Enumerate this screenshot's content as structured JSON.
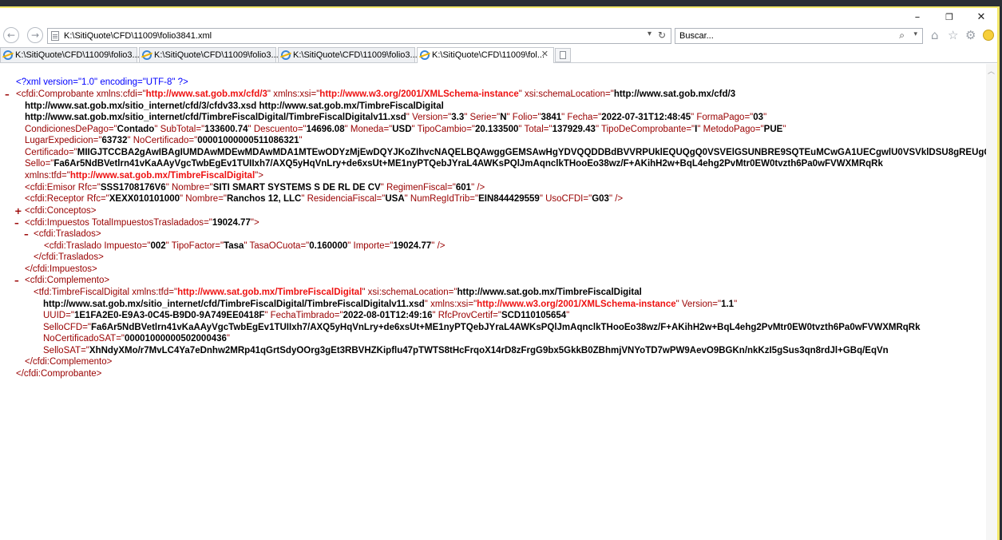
{
  "window": {
    "minimize": "–",
    "maximize": "❐",
    "close": "✕"
  },
  "nav": {
    "back_icon": "arrow-left",
    "forward_icon": "arrow-right",
    "address": "K:\\SitiQuote\\CFD\\11009\\folio3841.xml",
    "dropdown": "▾",
    "refresh": "↻",
    "search_placeholder": "Buscar...",
    "search_icon": "⌕",
    "search_dropdown": "▾",
    "home_icon": "⌂",
    "star_icon": "☆",
    "gear_icon": "⚙"
  },
  "tabs": [
    {
      "label": "K:\\SitiQuote\\CFD\\11009\\folio3...",
      "active": false
    },
    {
      "label": "K:\\SitiQuote\\CFD\\11009\\folio3...",
      "active": false
    },
    {
      "label": "K:\\SitiQuote\\CFD\\11009\\folio3...",
      "active": false
    },
    {
      "label": "K:\\SitiQuote\\CFD\\11009\\fol...",
      "active": true,
      "close": "✕"
    }
  ],
  "xml": {
    "decl": "<?xml version=\"1.0\" encoding=\"UTF-8\" ?>",
    "comprobante": {
      "toggle": "–",
      "open": "<cfdi:Comprobante",
      "xmlns_cfdi": "xmlns:cfdi",
      "xmlns_cfdi_val": "http://www.sat.gob.mx/cfd/3",
      "xmlns_xsi": "xmlns:xsi",
      "xmlns_xsi_val": "http://www.w3.org/2001/XMLSchema-instance",
      "schemaLocation": "xsi:schemaLocation",
      "schemaLocation_val1": "http://www.sat.gob.mx/cfd/3",
      "schemaLocation_val2": "http://www.sat.gob.mx/sitio_internet/cfd/3/cfdv33.xsd http://www.sat.gob.mx/TimbreFiscalDigital",
      "schemaLocation_val3": "http://www.sat.gob.mx/sitio_internet/cfd/TimbreFiscalDigital/TimbreFiscalDigitalv11.xsd",
      "Version": "Version",
      "Version_val": "3.3",
      "Serie": "Serie",
      "Serie_val": "N",
      "Folio": "Folio",
      "Folio_val": "3841",
      "Fecha": "Fecha",
      "Fecha_val": "2022-07-31T12:48:45",
      "FormaPago": "FormaPago",
      "FormaPago_val": "03",
      "CondicionesDePago": "CondicionesDePago",
      "CondicionesDePago_val": "Contado",
      "SubTotal": "SubTotal",
      "SubTotal_val": "133600.74",
      "Descuento": "Descuento",
      "Descuento_val": "14696.08",
      "Moneda": "Moneda",
      "Moneda_val": "USD",
      "TipoCambio": "TipoCambio",
      "TipoCambio_val": "20.133500",
      "Total": "Total",
      "Total_val": "137929.43",
      "TipoDeComprobante": "TipoDeComprobante",
      "TipoDeComprobante_val": "I",
      "MetodoPago": "MetodoPago",
      "MetodoPago_val": "PUE",
      "LugarExpedicion": "LugarExpedicion",
      "LugarExpedicion_val": "63732",
      "NoCertificado": "NoCertificado",
      "NoCertificado_val": "00001000000511086321",
      "Certificado": "Certificado",
      "Certificado_val": "MIIGJTCCBA2gAwIBAgIUMDAwMDEwMDAwMDA1MTEwODYzMjEwDQYJKoZIhvcNAQELBQAwggGEMSAwHgYDVQQDDBdBVVRPUklEQUQgQ0VSVElGSUNBRE9SQTEuMCwGA1UECgwlU0VSVklDSU8gREUgQURNSU5JU1RSQUNJT04",
      "Sello": "Sello",
      "Sello_val": "Fa6Ar5NdBVetlrn41vKaAAyVgcTwbEgEv1TUIIxh7/AXQ5yHqVnLry+de6xsUt+ME1nyPTQebJYraL4AWKsPQlJmAqnclkTHooEo38wz/F+AKihH2w+BqL4ehg2PvMtr0EW0tvzth6Pa0wFVWXMRqRk",
      "xmlns_tfd": "xmlns:tfd",
      "xmlns_tfd_val": "http://www.sat.gob.mx/TimbreFiscalDigital",
      "close_bracket": ">"
    },
    "emisor": {
      "open": "<cfdi:Emisor",
      "Rfc": "Rfc",
      "Rfc_val": "SSS1708176V6",
      "Nombre": "Nombre",
      "Nombre_val": "SITI SMART SYSTEMS S DE RL DE CV",
      "RegimenFiscal": "RegimenFiscal",
      "RegimenFiscal_val": "601",
      "end": "/>"
    },
    "receptor": {
      "open": "<cfdi:Receptor",
      "Rfc": "Rfc",
      "Rfc_val": "XEXX010101000",
      "Nombre": "Nombre",
      "Nombre_val": "Ranchos 12, LLC",
      "ResidenciaFiscal": "ResidenciaFiscal",
      "ResidenciaFiscal_val": "USA",
      "NumRegIdTrib": "NumRegIdTrib",
      "NumRegIdTrib_val": "EIN844429559",
      "UsoCFDI": "UsoCFDI",
      "UsoCFDI_val": "G03",
      "end": "/>"
    },
    "conceptos": {
      "toggle": "+",
      "tag": "<cfdi:Conceptos>"
    },
    "impuestos": {
      "toggle": "–",
      "open": "<cfdi:Impuestos",
      "TotalImpuestosTrasladados": "TotalImpuestosTrasladados",
      "TotalImpuestosTrasladados_val": "19024.77",
      "close_bracket": ">",
      "close": "</cfdi:Impuestos>"
    },
    "traslados": {
      "toggle": "–",
      "open": "<cfdi:Traslados>",
      "close": "</cfdi:Traslados>"
    },
    "traslado": {
      "open": "<cfdi:Traslado",
      "Impuesto": "Impuesto",
      "Impuesto_val": "002",
      "TipoFactor": "TipoFactor",
      "TipoFactor_val": "Tasa",
      "TasaOCuota": "TasaOCuota",
      "TasaOCuota_val": "0.160000",
      "Importe": "Importe",
      "Importe_val": "19024.77",
      "end": "/>"
    },
    "complemento": {
      "toggle": "–",
      "open": "<cfdi:Complemento>",
      "close": "</cfdi:Complemento>"
    },
    "timbre": {
      "open": "<tfd:TimbreFiscalDigital",
      "xmlns_tfd": "xmlns:tfd",
      "xmlns_tfd_val": "http://www.sat.gob.mx/TimbreFiscalDigital",
      "schemaLocation": "xsi:schemaLocation",
      "schemaLocation_val1": "http://www.sat.gob.mx/TimbreFiscalDigital",
      "schemaLocation_val2": "http://www.sat.gob.mx/sitio_internet/cfd/TimbreFiscalDigital/TimbreFiscalDigitalv11.xsd",
      "xmlns_xsi": "xmlns:xsi",
      "xmlns_xsi_val": "http://www.w3.org/2001/XMLSchema-instance",
      "Version": "Version",
      "Version_val": "1.1",
      "UUID": "UUID",
      "UUID_val": "1E1FA2E0-E9A3-0C45-B9D0-9A749EE0418F",
      "FechaTimbrado": "FechaTimbrado",
      "FechaTimbrado_val": "2022-08-01T12:49:16",
      "RfcProvCertif": "RfcProvCertif",
      "RfcProvCertif_val": "SCD110105654",
      "SelloCFD": "SelloCFD",
      "SelloCFD_val": "Fa6Ar5NdBVetlrn41vKaAAyVgcTwbEgEv1TUIIxh7/AXQ5yHqVnLry+de6xsUt+ME1nyPTQebJYraL4AWKsPQlJmAqnclkTHooEo38wz/F+AKihH2w+BqL4ehg2PvMtr0EW0tvzth6Pa0wFVWXMRqRk",
      "NoCertificadoSAT": "NoCertificadoSAT",
      "NoCertificadoSAT_val": "00001000000502000436",
      "SelloSAT": "SelloSAT",
      "SelloSAT_val": "XhNdyXMo/r7MvLC4Ya7eDnhw2MRp41qGrtSdyOOrg3gEt3RBVHZKipflu47pTWTS8tHcFrqoX14rD8zFrgG9bx5GkkB0ZBhmjVNYoTD7wPW9AevO9BGKn/nkKzI5gSus3qn8rdJl+GBq/EqVn",
      "end": "/>"
    },
    "comprobante_close": "</cfdi:Comprobante>"
  }
}
